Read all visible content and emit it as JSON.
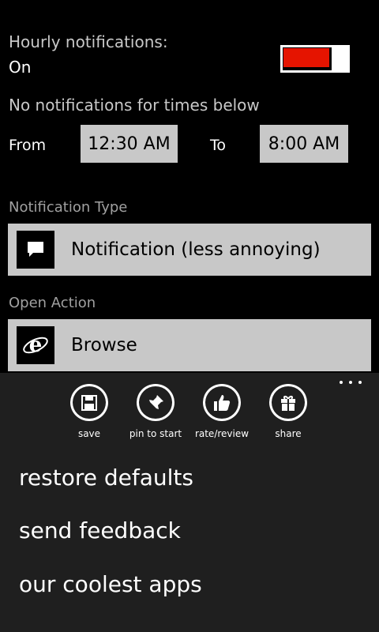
{
  "hourly": {
    "label": "Hourly notifications:",
    "value": "On",
    "toggle_on": true,
    "accent_color": "#e51400"
  },
  "quiet_hours": {
    "heading": "No notifications for times below",
    "from_label": "From",
    "from_time": "12:30 AM",
    "to_label": "To",
    "to_time": "8:00 AM"
  },
  "notification_type": {
    "heading": "Notification Type",
    "value": "Notification (less annoying)",
    "icon": "speech-bubble-icon"
  },
  "open_action": {
    "heading": "Open Action",
    "value": "Browse",
    "icon": "internet-explorer-icon"
  },
  "app_bar": {
    "buttons": [
      {
        "label": "save",
        "icon": "save-icon"
      },
      {
        "label": "pin to start",
        "icon": "pin-icon"
      },
      {
        "label": "rate/review",
        "icon": "thumbs-up-icon"
      },
      {
        "label": "share",
        "icon": "gift-icon"
      }
    ],
    "menu_items": [
      "restore defaults",
      "send feedback",
      "our coolest apps"
    ]
  }
}
